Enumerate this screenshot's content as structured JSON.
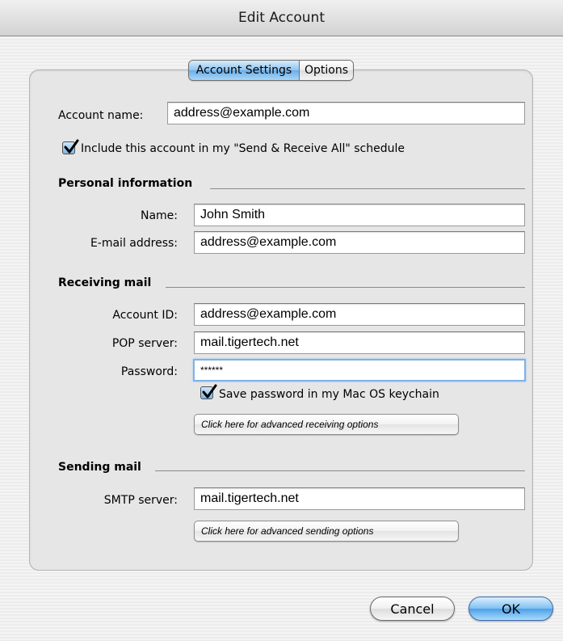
{
  "window": {
    "title": "Edit Account"
  },
  "tabs": [
    {
      "label": "Account Settings",
      "selected": true
    },
    {
      "label": "Options",
      "selected": false
    }
  ],
  "account": {
    "name_label": "Account name:",
    "name_value": "address@example.com",
    "include_label": "Include this account in my \"Send & Receive All\" schedule",
    "include_checked": true
  },
  "personal": {
    "heading": "Personal information",
    "name_label": "Name:",
    "name_value": "John Smith",
    "email_label": "E-mail address:",
    "email_value": "address@example.com"
  },
  "receiving": {
    "heading": "Receiving mail",
    "account_id_label": "Account ID:",
    "account_id_value": "address@example.com",
    "pop_label": "POP server:",
    "pop_value": "mail.tigertech.net",
    "password_label": "Password:",
    "password_value": "******",
    "keychain_label": "Save password in my Mac OS keychain",
    "keychain_checked": true,
    "advanced_label": "Click here for advanced receiving options"
  },
  "sending": {
    "heading": "Sending mail",
    "smtp_label": "SMTP server:",
    "smtp_value": "mail.tigertech.net",
    "advanced_label": "Click here for advanced sending options"
  },
  "buttons": {
    "cancel": "Cancel",
    "ok": "OK"
  },
  "colors": {
    "accent": "#6aaee8",
    "focus_ring": "#7fb2e6"
  }
}
